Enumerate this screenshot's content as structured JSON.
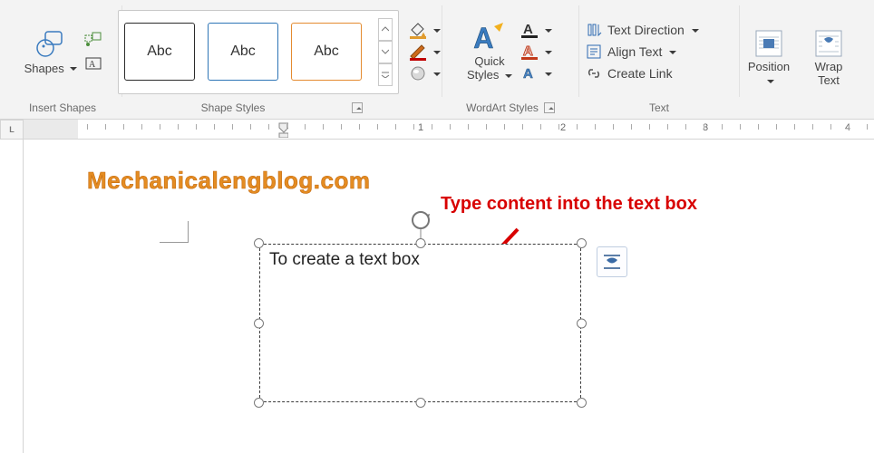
{
  "ribbon": {
    "groups": {
      "insert_shapes": {
        "label": "Insert Shapes",
        "shapes_btn": "Shapes"
      },
      "shape_styles": {
        "label": "Shape Styles",
        "swatch_text": "Abc",
        "fill": "Shape Fill",
        "outline": "Shape Outline",
        "effects": "Shape Effects"
      },
      "wordart_styles": {
        "label": "WordArt Styles",
        "quick_styles": "Quick\nStyles",
        "text_fill": "Text Fill",
        "text_outline": "Text Outline",
        "text_effects": "Text Effects"
      },
      "text": {
        "label": "Text",
        "direction": "Text Direction",
        "align": "Align Text",
        "link": "Create Link"
      },
      "arrange": {
        "position": "Position",
        "wrap": "Wrap\nText"
      }
    }
  },
  "ruler": {
    "marks": [
      "1",
      "2",
      "3",
      "4"
    ]
  },
  "document": {
    "watermark": "Mechanicalengblog.com",
    "textbox_content": "To create a text box",
    "callout": "Type content into the text box"
  }
}
